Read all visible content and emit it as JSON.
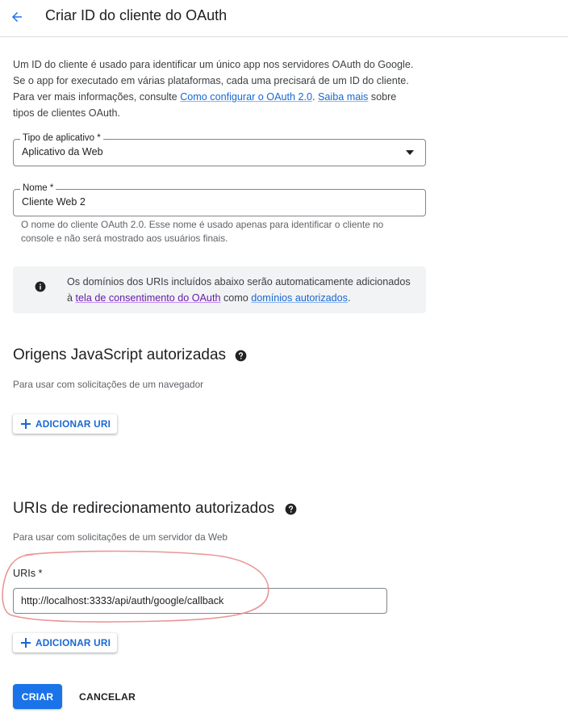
{
  "header": {
    "title": "Criar ID do cliente do OAuth",
    "back_icon": "arrow-back-icon"
  },
  "intro": {
    "text_1": "Um ID do cliente é usado para identificar um único app nos servidores OAuth do Google. Se o app for executado em várias plataformas, cada uma precisará de um ID do cliente. Para ver mais informações, consulte ",
    "link_1": "Como configurar o OAuth 2.0",
    "text_2": ". ",
    "link_2": "Saiba mais",
    "text_3": " sobre tipos de clientes OAuth."
  },
  "app_type": {
    "label": "Tipo de aplicativo *",
    "value": "Aplicativo da Web"
  },
  "name_field": {
    "label": "Nome *",
    "value": "Cliente Web 2",
    "hint": "O nome do cliente OAuth 2.0. Esse nome é usado apenas para identificar o cliente no console e não será mostrado aos usuários finais."
  },
  "info_box": {
    "text_1": "Os domínios dos URIs incluídos abaixo serão automaticamente adicionados à ",
    "link_1": "tela de consentimento do OAuth",
    "text_2": " como ",
    "link_2": "domínios autorizados",
    "text_3": "."
  },
  "js_origins": {
    "title": "Origens JavaScript autorizadas",
    "subtitle": "Para usar com solicitações de um navegador",
    "add_label": "ADICIONAR URI"
  },
  "redirect_uris": {
    "title": "URIs de redirecionamento autorizados",
    "subtitle": "Para usar com solicitações de um servidor da Web",
    "uris_label": "URIs *",
    "uri_value": "http://localhost:3333/api/auth/google/callback",
    "add_label": "ADICIONAR URI"
  },
  "actions": {
    "create_label": "CRIAR",
    "cancel_label": "CANCELAR"
  },
  "colors": {
    "primary": "#1a73e8",
    "link": "#1967d2",
    "visited_link": "#681da8",
    "annotation": "#e88a8a",
    "info_bg": "#f1f3f4"
  }
}
